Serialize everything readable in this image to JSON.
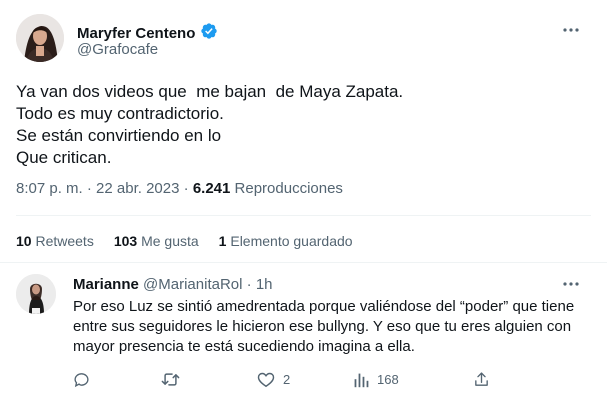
{
  "tweet": {
    "author_name": "Maryfer Centeno",
    "author_handle": "@Grafocafe",
    "text": "Ya van dos videos que  me bajan  de Maya Zapata.\nTodo es muy contradictorio.\nSe están convirtiendo en lo\nQue critican.",
    "time": "8:07 p. m.",
    "date_sep": " · ",
    "date": "22 abr. 2023",
    "dot_sep": " · ",
    "views_count": "6.241",
    "views_label": " Reproducciones",
    "retweets_count": "10",
    "retweets_label": " Retweets",
    "likes_count": "103",
    "likes_label": " Me gusta",
    "bookmarks_count": "1",
    "bookmarks_label": " Elemento guardado"
  },
  "reply": {
    "author_name": "Marianne",
    "author_handle": "@MarianitaRol",
    "separator": " · ",
    "time": "1h",
    "text": "Por eso Luz se sintió amedrentada porque valiéndose del “poder” que tiene entre sus seguidores le hicieron ese bullyng.  Y eso que tu eres alguien con mayor presencia te está sucediendo imagina a ella.",
    "likes_count": "2",
    "views_count": "168"
  },
  "colors": {
    "text": "#0f1419",
    "secondary": "#536471",
    "verified": "#1d9bf0",
    "divider": "#eff3f4"
  },
  "icons": [
    "more-icon",
    "verified-badge-icon",
    "reply-icon",
    "retweet-icon",
    "like-icon",
    "views-icon",
    "share-icon"
  ]
}
